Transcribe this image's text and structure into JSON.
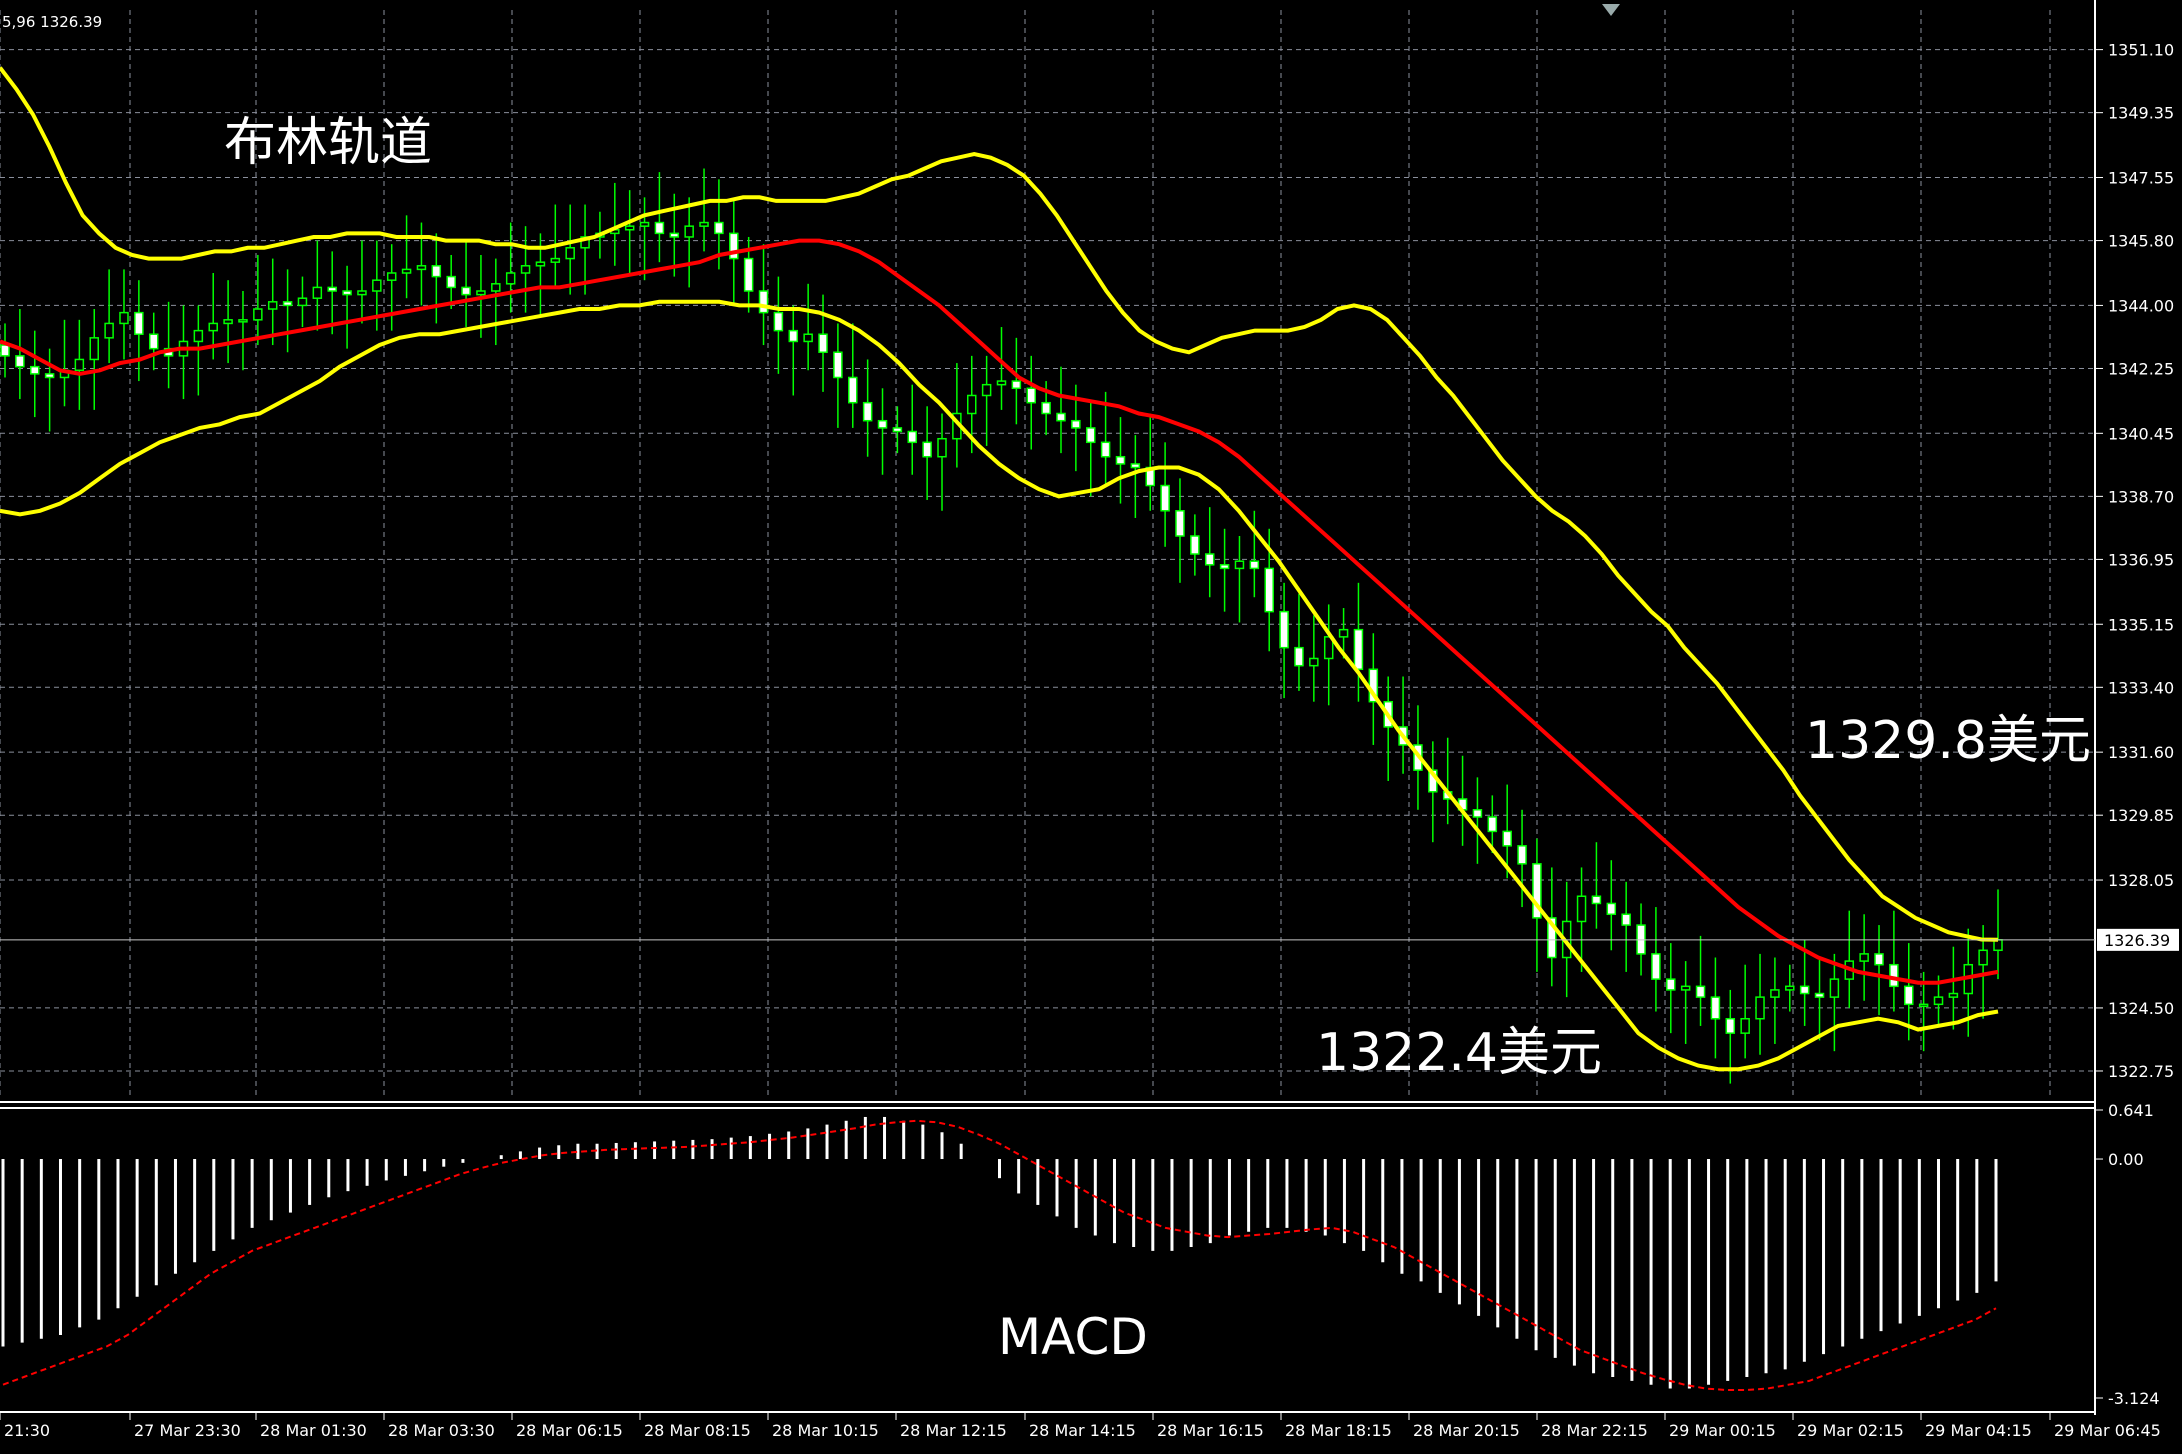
{
  "header": {
    "ohlc_text": "5,96 1326.39"
  },
  "annotations": {
    "bollinger_title": "布林轨道",
    "upper_value": "1329.8美元",
    "lower_value": "1322.4美元",
    "macd_title": "MACD"
  },
  "price_panel": {
    "y_ticks": [
      "1351.10",
      "1349.35",
      "1347.55",
      "1345.80",
      "1344.00",
      "1342.25",
      "1340.45",
      "1338.70",
      "1336.95",
      "1335.15",
      "1333.40",
      "1331.60",
      "1329.85",
      "1328.05",
      "1324.50",
      "1322.75"
    ],
    "current_price_label": "1326.39"
  },
  "macd_panel": {
    "y_ticks": [
      "0.641",
      "0.00",
      "-3.124"
    ]
  },
  "x_ticks": [
    "21:30",
    "27 Mar 23:30",
    "28 Mar 01:30",
    "28 Mar 03:30",
    "28 Mar 06:15",
    "28 Mar 08:15",
    "28 Mar 10:15",
    "28 Mar 12:15",
    "28 Mar 14:15",
    "28 Mar 16:15",
    "28 Mar 18:15",
    "28 Mar 20:15",
    "28 Mar 22:15",
    "29 Mar 00:15",
    "29 Mar 02:15",
    "29 Mar 04:15",
    "29 Mar 06:45"
  ],
  "colors": {
    "background": "#000000",
    "grid": "#8a8f9c",
    "candle": "#00ff00",
    "bollinger": "#ffff00",
    "middle_band": "#ff0000",
    "macd_hist": "#ffffff",
    "signal": "#ff0000",
    "axis_text": "#ffffff"
  },
  "chart_data": [
    {
      "type": "line",
      "title": "布林轨道",
      "ylim": [
        1322.0,
        1352.2
      ],
      "series": [
        {
          "name": "price",
          "values": [
            1342.6,
            1342.3,
            1342.1,
            1342.0,
            1342.2,
            1342.5,
            1343.1,
            1343.5,
            1343.8,
            1343.2,
            1342.8,
            1342.6,
            1343.0,
            1343.3,
            1343.5,
            1343.6,
            1343.6,
            1343.9,
            1344.1,
            1344.0,
            1344.2,
            1344.5,
            1344.4,
            1344.3,
            1344.4,
            1344.7,
            1344.9,
            1345.0,
            1345.1,
            1344.8,
            1344.5,
            1344.3,
            1344.4,
            1344.6,
            1344.9,
            1345.1,
            1345.2,
            1345.3,
            1345.6,
            1345.9,
            1346.0,
            1346.1,
            1346.2,
            1346.3,
            1346.0,
            1345.9,
            1346.2,
            1346.3,
            1346.0,
            1345.3,
            1344.4,
            1343.8,
            1343.3,
            1343.0,
            1343.2,
            1342.7,
            1342.0,
            1341.3,
            1340.8,
            1340.6,
            1340.5,
            1340.2,
            1339.8,
            1340.3,
            1341.0,
            1341.5,
            1341.8,
            1341.9,
            1341.7,
            1341.3,
            1341.0,
            1340.8,
            1340.6,
            1340.2,
            1339.8,
            1339.6,
            1339.5,
            1339.0,
            1338.3,
            1337.6,
            1337.1,
            1336.8,
            1336.7,
            1336.9,
            1336.7,
            1335.5,
            1334.5,
            1334.0,
            1334.2,
            1334.8,
            1335.0,
            1333.9,
            1333.0,
            1332.3,
            1331.8,
            1331.1,
            1330.5,
            1330.3,
            1330.0,
            1329.8,
            1329.4,
            1329.0,
            1328.5,
            1327.0,
            1325.9,
            1326.9,
            1327.6,
            1327.4,
            1327.1,
            1326.8,
            1326.0,
            1325.3,
            1325.0,
            1325.1,
            1324.8,
            1324.2,
            1323.8,
            1324.2,
            1324.8,
            1325.0,
            1325.1,
            1324.9,
            1324.8,
            1325.3,
            1325.8,
            1326.0,
            1325.7,
            1325.1,
            1324.6,
            1324.6,
            1324.8,
            1324.9,
            1325.7,
            1326.1,
            1326.39
          ]
        },
        {
          "name": "upper",
          "values": [
            1350.6,
            1350.0,
            1349.3,
            1348.4,
            1347.4,
            1346.5,
            1346.0,
            1345.6,
            1345.4,
            1345.3,
            1345.3,
            1345.3,
            1345.4,
            1345.5,
            1345.5,
            1345.6,
            1345.6,
            1345.7,
            1345.8,
            1345.9,
            1345.9,
            1346.0,
            1346.0,
            1346.0,
            1345.9,
            1345.9,
            1345.9,
            1345.8,
            1345.8,
            1345.8,
            1345.7,
            1345.7,
            1345.6,
            1345.6,
            1345.7,
            1345.8,
            1345.9,
            1346.1,
            1346.3,
            1346.5,
            1346.6,
            1346.7,
            1346.8,
            1346.9,
            1346.9,
            1347.0,
            1347.0,
            1346.9,
            1346.9,
            1346.9,
            1346.9,
            1347.0,
            1347.1,
            1347.3,
            1347.5,
            1347.6,
            1347.8,
            1348.0,
            1348.1,
            1348.2,
            1348.1,
            1347.9,
            1347.6,
            1347.1,
            1346.5,
            1345.8,
            1345.1,
            1344.4,
            1343.8,
            1343.3,
            1343.0,
            1342.8,
            1342.7,
            1342.9,
            1343.1,
            1343.2,
            1343.3,
            1343.3,
            1343.3,
            1343.4,
            1343.6,
            1343.9,
            1344.0,
            1343.9,
            1343.6,
            1343.1,
            1342.6,
            1342.0,
            1341.5,
            1340.9,
            1340.3,
            1339.7,
            1339.2,
            1338.7,
            1338.3,
            1338.0,
            1337.6,
            1337.1,
            1336.5,
            1336.0,
            1335.5,
            1335.1,
            1334.5,
            1334.0,
            1333.5,
            1332.9,
            1332.3,
            1331.7,
            1331.1,
            1330.4,
            1329.8,
            1329.2,
            1328.6,
            1328.1,
            1327.6,
            1327.3,
            1327.0,
            1326.8,
            1326.6,
            1326.5,
            1326.4,
            1326.39
          ]
        },
        {
          "name": "middle",
          "values": [
            1343.0,
            1342.8,
            1342.5,
            1342.2,
            1342.1,
            1342.2,
            1342.4,
            1342.5,
            1342.7,
            1342.8,
            1342.8,
            1342.9,
            1343.0,
            1343.1,
            1343.2,
            1343.3,
            1343.4,
            1343.5,
            1343.6,
            1343.7,
            1343.8,
            1343.9,
            1344.0,
            1344.1,
            1344.2,
            1344.3,
            1344.4,
            1344.5,
            1344.5,
            1344.6,
            1344.7,
            1344.8,
            1344.9,
            1345.0,
            1345.1,
            1345.2,
            1345.4,
            1345.5,
            1345.6,
            1345.7,
            1345.8,
            1345.8,
            1345.7,
            1345.5,
            1345.2,
            1344.8,
            1344.4,
            1344.0,
            1343.5,
            1343.0,
            1342.5,
            1342.0,
            1341.7,
            1341.5,
            1341.4,
            1341.3,
            1341.2,
            1341.0,
            1340.9,
            1340.7,
            1340.5,
            1340.2,
            1339.8,
            1339.3,
            1338.8,
            1338.3,
            1337.8,
            1337.3,
            1336.8,
            1336.3,
            1335.8,
            1335.3,
            1334.8,
            1334.3,
            1333.8,
            1333.3,
            1332.8,
            1332.3,
            1331.8,
            1331.3,
            1330.8,
            1330.3,
            1329.8,
            1329.3,
            1328.8,
            1328.3,
            1327.8,
            1327.3,
            1326.9,
            1326.5,
            1326.2,
            1325.9,
            1325.7,
            1325.5,
            1325.4,
            1325.3,
            1325.2,
            1325.2,
            1325.3,
            1325.4,
            1325.5
          ]
        },
        {
          "name": "lower",
          "values": [
            1338.3,
            1338.2,
            1338.3,
            1338.5,
            1338.8,
            1339.2,
            1339.6,
            1339.9,
            1340.2,
            1340.4,
            1340.6,
            1340.7,
            1340.9,
            1341.0,
            1341.3,
            1341.6,
            1341.9,
            1342.3,
            1342.6,
            1342.9,
            1343.1,
            1343.2,
            1343.2,
            1343.3,
            1343.4,
            1343.5,
            1343.6,
            1343.7,
            1343.8,
            1343.9,
            1343.9,
            1344.0,
            1344.0,
            1344.1,
            1344.1,
            1344.1,
            1344.1,
            1344.0,
            1344.0,
            1343.9,
            1343.9,
            1343.8,
            1343.6,
            1343.3,
            1342.9,
            1342.4,
            1341.8,
            1341.3,
            1340.7,
            1340.1,
            1339.6,
            1339.2,
            1338.9,
            1338.7,
            1338.8,
            1338.9,
            1339.2,
            1339.4,
            1339.5,
            1339.5,
            1339.3,
            1338.9,
            1338.3,
            1337.6,
            1336.9,
            1336.1,
            1335.3,
            1334.5,
            1333.8,
            1333.0,
            1332.2,
            1331.5,
            1330.8,
            1330.1,
            1329.4,
            1328.7,
            1328.0,
            1327.3,
            1326.6,
            1325.9,
            1325.2,
            1324.5,
            1323.8,
            1323.4,
            1323.1,
            1322.9,
            1322.8,
            1322.8,
            1322.9,
            1323.1,
            1323.4,
            1323.7,
            1324.0,
            1324.1,
            1324.2,
            1324.1,
            1323.9,
            1324.0,
            1324.1,
            1324.3,
            1324.4
          ]
        }
      ]
    },
    {
      "type": "bar",
      "title": "MACD",
      "ylim": [
        -3.124,
        0.641
      ],
      "series": [
        {
          "name": "histogram",
          "values": [
            -2.45,
            -2.4,
            -2.35,
            -2.3,
            -2.2,
            -2.1,
            -1.95,
            -1.8,
            -1.65,
            -1.5,
            -1.35,
            -1.2,
            -1.05,
            -0.9,
            -0.8,
            -0.7,
            -0.6,
            -0.5,
            -0.42,
            -0.35,
            -0.28,
            -0.22,
            -0.16,
            -0.1,
            -0.05,
            0.0,
            0.05,
            0.1,
            0.15,
            0.18,
            0.2,
            0.2,
            0.21,
            0.22,
            0.23,
            0.24,
            0.25,
            0.26,
            0.28,
            0.3,
            0.33,
            0.36,
            0.4,
            0.45,
            0.5,
            0.55,
            0.55,
            0.5,
            0.45,
            0.35,
            0.2,
            0.0,
            -0.25,
            -0.45,
            -0.6,
            -0.75,
            -0.9,
            -1.0,
            -1.1,
            -1.15,
            -1.2,
            -1.2,
            -1.15,
            -1.1,
            -1.0,
            -0.95,
            -0.9,
            -0.9,
            -0.95,
            -1.0,
            -1.1,
            -1.2,
            -1.35,
            -1.5,
            -1.6,
            -1.75,
            -1.9,
            -2.05,
            -2.2,
            -2.35,
            -2.5,
            -2.6,
            -2.7,
            -2.8,
            -2.85,
            -2.9,
            -2.95,
            -3.0,
            -3.0,
            -2.95,
            -2.9,
            -2.85,
            -2.8,
            -2.75,
            -2.65,
            -2.55,
            -2.45,
            -2.35,
            -2.25,
            -2.15,
            -2.05,
            -1.95,
            -1.85,
            -1.75,
            -1.6
          ]
        },
        {
          "name": "signal",
          "values": [
            -2.95,
            -2.85,
            -2.75,
            -2.65,
            -2.55,
            -2.45,
            -2.3,
            -2.1,
            -1.9,
            -1.7,
            -1.5,
            -1.35,
            -1.2,
            -1.1,
            -1.0,
            -0.9,
            -0.8,
            -0.7,
            -0.6,
            -0.5,
            -0.4,
            -0.3,
            -0.2,
            -0.12,
            -0.05,
            0.0,
            0.05,
            0.08,
            0.1,
            0.12,
            0.13,
            0.14,
            0.15,
            0.16,
            0.18,
            0.2,
            0.22,
            0.25,
            0.28,
            0.32,
            0.36,
            0.4,
            0.45,
            0.48,
            0.5,
            0.48,
            0.42,
            0.32,
            0.2,
            0.05,
            -0.1,
            -0.25,
            -0.4,
            -0.55,
            -0.7,
            -0.8,
            -0.9,
            -0.95,
            -1.0,
            -1.02,
            -1.0,
            -0.98,
            -0.95,
            -0.92,
            -0.9,
            -0.95,
            -1.05,
            -1.15,
            -1.3,
            -1.45,
            -1.6,
            -1.75,
            -1.9,
            -2.05,
            -2.2,
            -2.35,
            -2.5,
            -2.6,
            -2.7,
            -2.8,
            -2.88,
            -2.95,
            -3.0,
            -3.02,
            -3.02,
            -3.0,
            -2.95,
            -2.9,
            -2.8,
            -2.7,
            -2.6,
            -2.5,
            -2.4,
            -2.3,
            -2.2,
            -2.1,
            -1.95
          ]
        }
      ]
    }
  ]
}
